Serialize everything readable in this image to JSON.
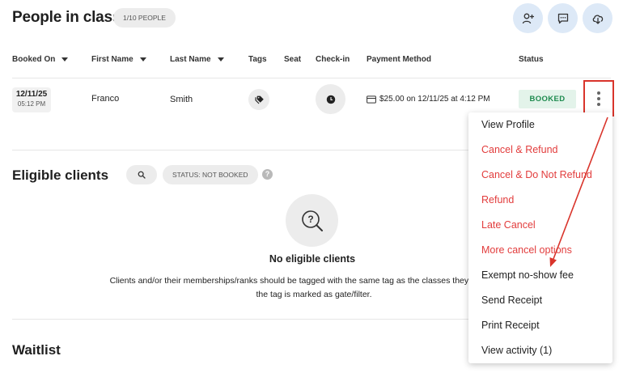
{
  "header": {
    "title": "People in class",
    "people_count": "1/10 PEOPLE",
    "actions": [
      {
        "icon": "add-person-icon"
      },
      {
        "icon": "message-icon"
      },
      {
        "icon": "download-cloud-icon"
      }
    ]
  },
  "table": {
    "columns": {
      "booked_on": "Booked On",
      "first_name": "First Name",
      "last_name": "Last Name",
      "tags": "Tags",
      "seat": "Seat",
      "checkin": "Check-in",
      "payment": "Payment Method",
      "status": "Status"
    },
    "row": {
      "date": "12/11/25",
      "time": "05:12 PM",
      "first_name": "Franco",
      "last_name": "Smith",
      "payment": "$25.00 on 12/11/25 at 4:12 PM",
      "status": "BOOKED"
    }
  },
  "eligible": {
    "title": "Eligible clients",
    "status_filter": "STATUS: NOT BOOKED",
    "help": "?",
    "empty_title": "No eligible clients",
    "empty_desc_line1": "Clients and/or their memberships/ranks should be tagged with the same tag as the classes they have access",
    "empty_desc_line2": "the tag is marked as gate/filter."
  },
  "waitlist": {
    "title": "Waitlist"
  },
  "menu": {
    "items": [
      {
        "label": "View Profile",
        "type": "normal"
      },
      {
        "label": "Cancel & Refund",
        "type": "danger"
      },
      {
        "label": "Cancel & Do Not Refund",
        "type": "danger"
      },
      {
        "label": "Refund",
        "type": "danger"
      },
      {
        "label": "Late Cancel",
        "type": "danger"
      },
      {
        "label": "More cancel options",
        "type": "danger"
      },
      {
        "label": "Exempt no-show fee",
        "type": "normal"
      },
      {
        "label": "Send Receipt",
        "type": "normal"
      },
      {
        "label": "Print Receipt",
        "type": "normal"
      },
      {
        "label": "View activity (1)",
        "type": "normal"
      }
    ]
  },
  "colors": {
    "accent_circle": "#dde9f7",
    "booked_bg": "#e3f3ea",
    "booked_text": "#1d8a4e",
    "danger": "#e23c3c",
    "annotation": "#d9342b"
  }
}
